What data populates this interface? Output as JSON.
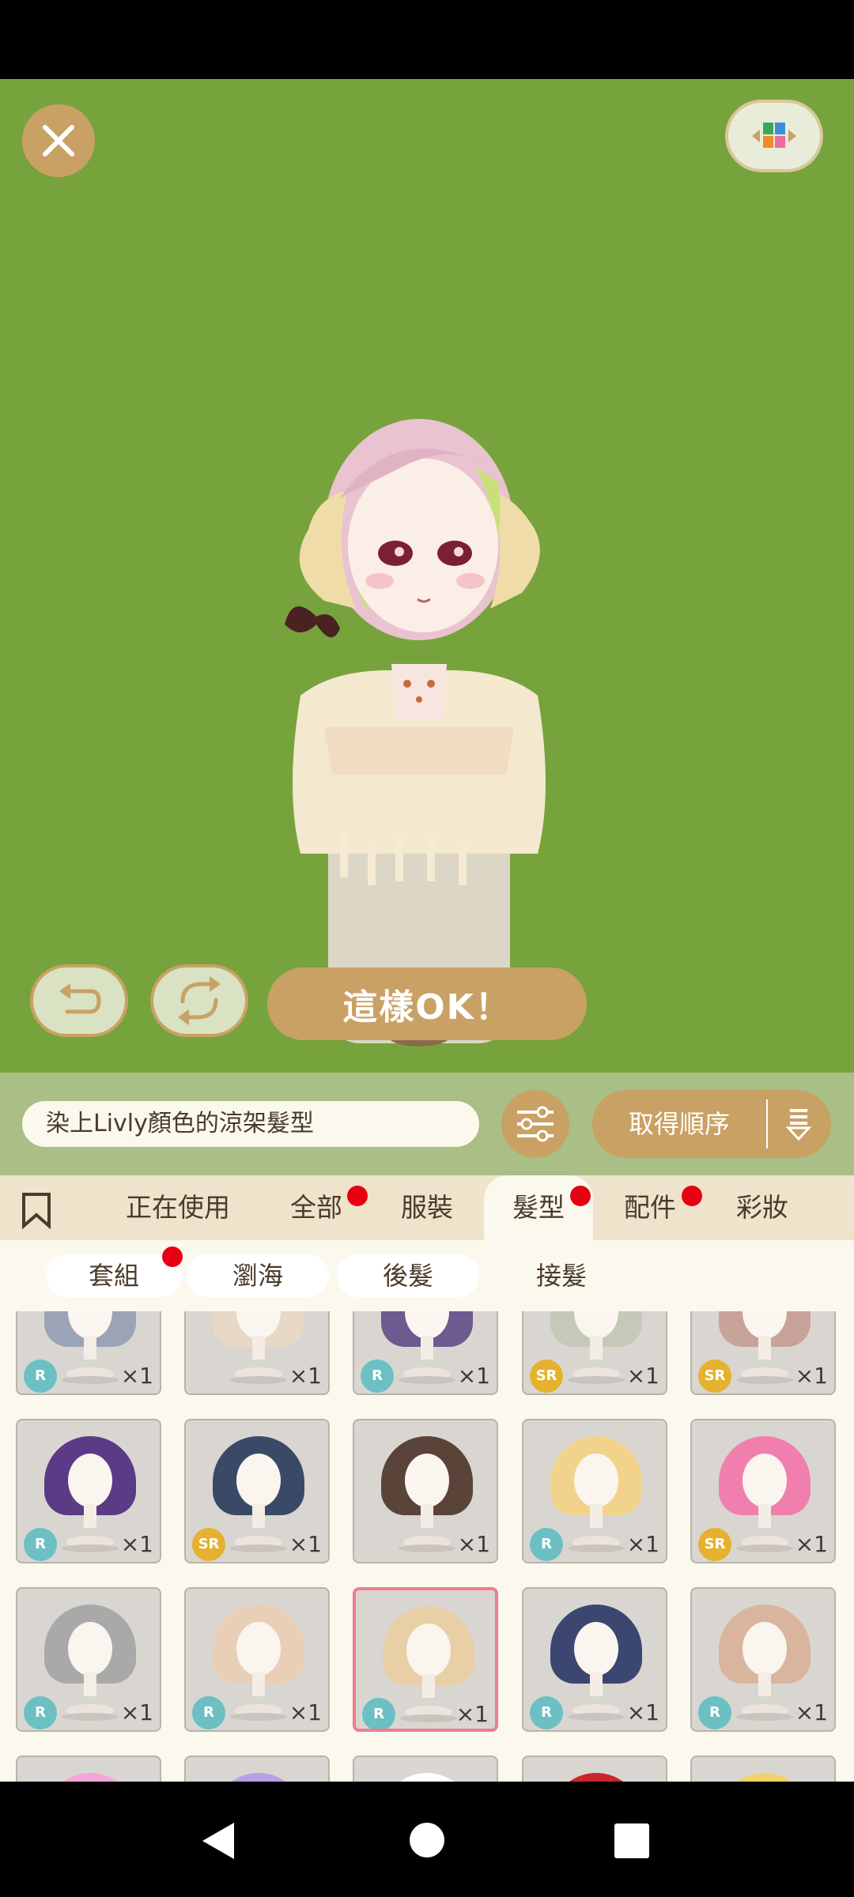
{
  "stage": {
    "background_color": "#77a33c",
    "close_icon": "close-icon",
    "layout_icon": "color-grid-icon",
    "undo_icon": "undo-icon",
    "rotate_icon": "rotate-icon",
    "ok_label": "這樣OK！"
  },
  "toolbar": {
    "search_text": "染上Livly顏色的涼架髮型",
    "filter_icon": "sliders-icon",
    "order_label": "取得順序",
    "sort_icon": "sort-order-icon"
  },
  "tabs": [
    {
      "label": "正在使用",
      "badge": false,
      "active": false
    },
    {
      "label": "全部",
      "badge": true,
      "active": false
    },
    {
      "label": "服裝",
      "badge": false,
      "active": false
    },
    {
      "label": "髮型",
      "badge": true,
      "active": true
    },
    {
      "label": "配件",
      "badge": true,
      "active": false
    },
    {
      "label": "彩妝",
      "badge": false,
      "active": false
    }
  ],
  "subtabs": [
    {
      "label": "套組",
      "badge": true
    },
    {
      "label": "瀏海",
      "badge": false
    },
    {
      "label": "後髮",
      "badge": false
    },
    {
      "label": "接髮",
      "badge": false
    }
  ],
  "items": [
    {
      "rarity": "R",
      "qty": "×1",
      "hair_color": "#9aa4b6"
    },
    {
      "rarity": "",
      "qty": "×1",
      "hair_color": "#e8d9c6"
    },
    {
      "rarity": "R",
      "qty": "×1",
      "hair_color": "#6d5a8f"
    },
    {
      "rarity": "SR",
      "qty": "×1",
      "hair_color": "#c4c9b8"
    },
    {
      "rarity": "SR",
      "qty": "×1",
      "hair_color": "#c8a39a"
    },
    {
      "rarity": "R",
      "qty": "×1",
      "hair_color": "#5b3a86"
    },
    {
      "rarity": "SR",
      "qty": "×1",
      "hair_color": "#3a4a66"
    },
    {
      "rarity": "",
      "qty": "×1",
      "hair_color": "#5a4338"
    },
    {
      "rarity": "R",
      "qty": "×1",
      "hair_color": "#f2d38c"
    },
    {
      "rarity": "SR",
      "qty": "×1",
      "hair_color": "#f07fae"
    },
    {
      "rarity": "R",
      "qty": "×1",
      "hair_color": "#a9a9a9"
    },
    {
      "rarity": "R",
      "qty": "×1",
      "hair_color": "#e9cfb5"
    },
    {
      "rarity": "R",
      "qty": "×1",
      "hair_color": "#e8cfa6",
      "selected": true
    },
    {
      "rarity": "R",
      "qty": "×1",
      "hair_color": "#3b4770"
    },
    {
      "rarity": "R",
      "qty": "×1",
      "hair_color": "#d8b59c"
    },
    {
      "rarity": "",
      "qty": "",
      "hair_color": "#f2a6dc"
    },
    {
      "rarity": "",
      "qty": "",
      "hair_color": "#b9a0e6"
    },
    {
      "rarity": "",
      "qty": "",
      "hair_color": "#ffffff"
    },
    {
      "rarity": "",
      "qty": "",
      "hair_color": "#c8282d"
    },
    {
      "rarity": "",
      "qty": "",
      "hair_color": "#efd36a"
    }
  ],
  "navbar": {
    "back_icon": "back-triangle-icon",
    "home_icon": "home-circle-icon",
    "recents_icon": "recents-square-icon"
  }
}
